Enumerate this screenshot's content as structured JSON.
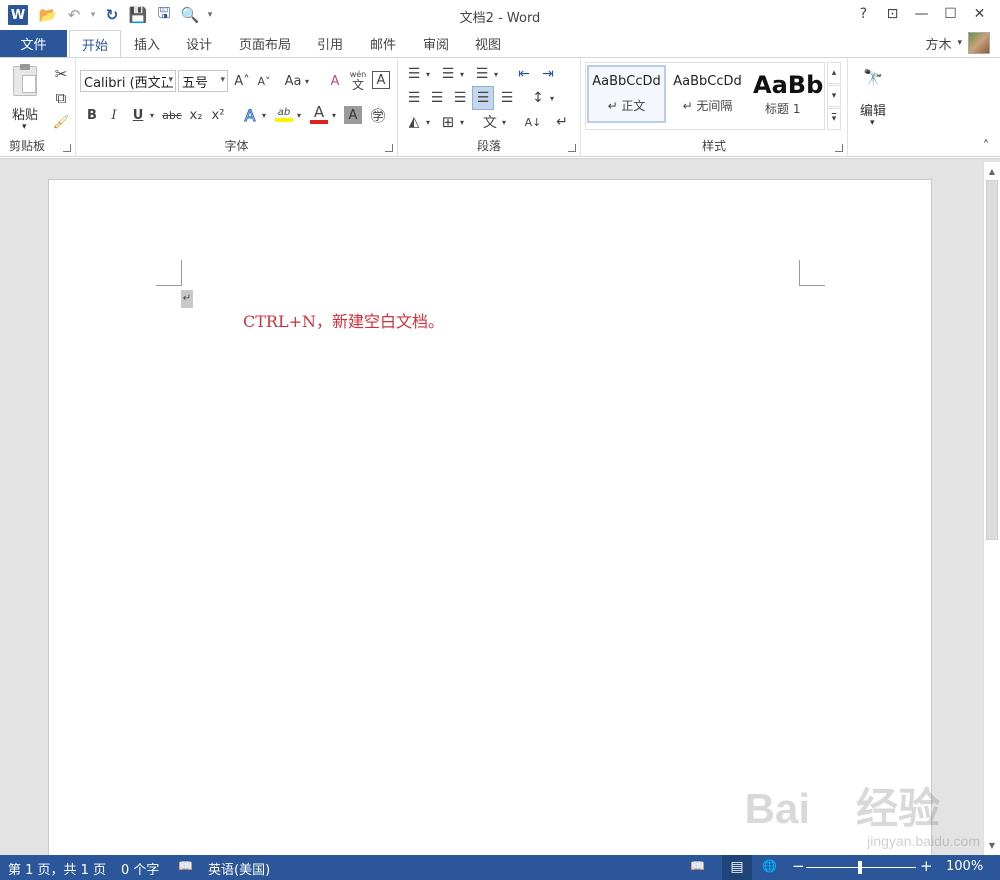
{
  "window": {
    "title": "文档2 - Word",
    "help": "?",
    "ribbon_display": "⊡",
    "minimize": "—",
    "maximize": "☐",
    "close": "✕"
  },
  "qat": {
    "app_icon": "W",
    "open": "📂",
    "undo": "↶",
    "redo": "↻",
    "save": "💾",
    "save_as": "🖫",
    "print_preview": "🔍",
    "customize": "▾"
  },
  "tabs": {
    "file": "文件",
    "items": [
      "开始",
      "插入",
      "设计",
      "页面布局",
      "引用",
      "邮件",
      "审阅",
      "视图"
    ],
    "active": "开始"
  },
  "user": {
    "name": "方木",
    "dropdown": "▾"
  },
  "clipboard": {
    "paste": "粘贴",
    "label": "剪贴板",
    "cut": "✂",
    "copy": "⧉",
    "format_painter": "🖌",
    "paste_arrow": "▾"
  },
  "font": {
    "label": "字体",
    "family": "Calibri (西文正",
    "size": "五号",
    "grow": "A˄",
    "shrink": "A˅",
    "change_case": "Aa",
    "clear": "A",
    "phonetic_top": "wén",
    "phonetic_bottom": "文",
    "border_char": "A",
    "bold": "B",
    "italic": "I",
    "underline": "U",
    "strike": "abc",
    "sub": "x₂",
    "sup": "x²",
    "effects": "A",
    "highlight": "ab",
    "color": "A",
    "shading": "A",
    "enclose": "㊫",
    "dropdown": "▾"
  },
  "paragraph": {
    "label": "段落",
    "bullets": "☰",
    "numbering": "☰",
    "multilevel": "☰",
    "dec_indent": "⇤",
    "inc_indent": "⇥",
    "align_left": "☰",
    "center": "☰",
    "align_right": "☰",
    "justify": "☰",
    "distributed": "☰",
    "line_spacing": "↕",
    "shading": "◭",
    "borders": "⊞",
    "chinese_layout": "文",
    "sort": "A↓",
    "show_marks": "↵",
    "dropdown": "▾"
  },
  "styles": {
    "label": "样式",
    "items": [
      {
        "preview": "AaBbCcDd",
        "name": "↵ 正文"
      },
      {
        "preview": "AaBbCcDd",
        "name": "↵ 无间隔"
      },
      {
        "preview": "AaBb",
        "name": "标题 1"
      }
    ],
    "up": "▴",
    "down": "▾",
    "more": "▾"
  },
  "editing": {
    "label": "编辑",
    "icon": "🔭",
    "dropdown": "▾"
  },
  "collapse_ribbon": "˄",
  "document": {
    "para_mark": "↵",
    "text": "CTRL+N，新建空白文档。",
    "text_color": "#d0303a"
  },
  "scrollbar": {
    "up": "▲",
    "down": "▼"
  },
  "status": {
    "page": "第 1 页，共 1 页",
    "words": "0 个字",
    "proof_icon": "📖",
    "language": "英语(美国)",
    "read_mode": "📖",
    "print_layout": "▤",
    "web_layout": "🌐",
    "zoom_out": "−",
    "zoom_in": "+",
    "zoom": "100%"
  },
  "watermark": {
    "logo": "Bai  经验",
    "url": "jingyan.baidu.com"
  }
}
